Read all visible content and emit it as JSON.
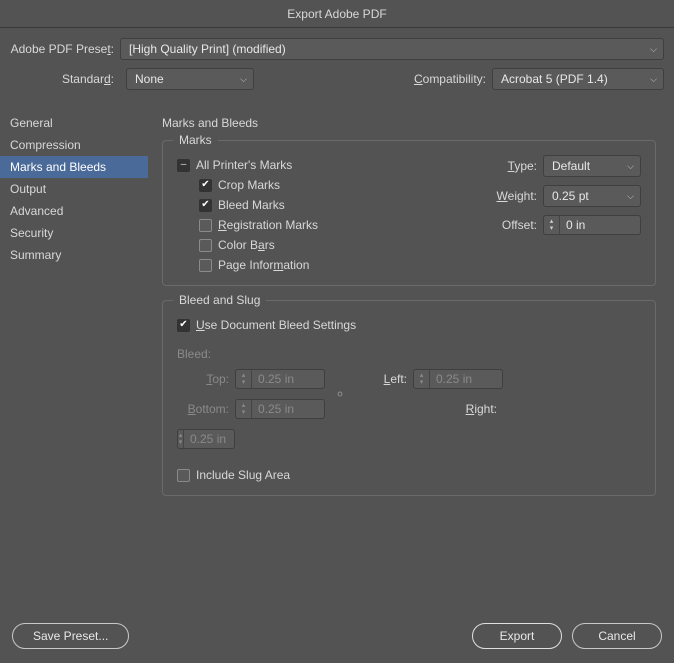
{
  "title": "Export Adobe PDF",
  "top": {
    "preset_label": "Adobe PDF Preset:",
    "preset_value": "[High Quality Print] (modified)",
    "standard_label": "Standard:",
    "standard_value": "None",
    "compat_label": "Compatibility:",
    "compat_letter": "C",
    "compat_rest": "ompatibility:",
    "compat_value": "Acrobat 5 (PDF 1.4)"
  },
  "sidebar": {
    "items": [
      {
        "label": "General"
      },
      {
        "label": "Compression"
      },
      {
        "label": "Marks and Bleeds"
      },
      {
        "label": "Output"
      },
      {
        "label": "Advanced"
      },
      {
        "label": "Security"
      },
      {
        "label": "Summary"
      }
    ],
    "selected_index": 2
  },
  "content": {
    "heading": "Marks and Bleeds",
    "marks": {
      "group_label": "Marks",
      "all_label": "All Printer's Marks",
      "crop_label": "Crop Marks",
      "bleed_label": "Bleed Marks",
      "reg_label_pre": "R",
      "reg_label_rest": "egistration Marks",
      "colorbars_pre": "Color B",
      "colorbars_u": "a",
      "colorbars_post": "rs",
      "pageinfo_pre": "Page Infor",
      "pageinfo_u": "m",
      "pageinfo_post": "ation",
      "type_label_u": "T",
      "type_label_rest": "ype:",
      "type_value": "Default",
      "weight_label_u": "W",
      "weight_label_rest": "eight:",
      "weight_value": "0.25 pt",
      "offset_label": "Offset:",
      "offset_value": "0 in"
    },
    "bleed": {
      "group_label": "Bleed and Slug",
      "use_doc_u": "U",
      "use_doc_rest": "se Document Bleed Settings",
      "bleed_heading": "Bleed:",
      "top_u": "T",
      "top_rest": "op:",
      "top_val": "0.25 in",
      "bottom_u": "B",
      "bottom_rest": "ottom:",
      "bottom_val": "0.25 in",
      "left_u": "L",
      "left_rest": "eft:",
      "left_val": "0.25 in",
      "right_u": "R",
      "right_rest": "ight:",
      "right_val": "0.25 in",
      "slug_pre": "Include Slu",
      "slug_u": "g",
      "slug_post": " Area"
    }
  },
  "footer": {
    "save_preset": "Save Preset...",
    "export": "Export",
    "cancel": "Cancel"
  }
}
